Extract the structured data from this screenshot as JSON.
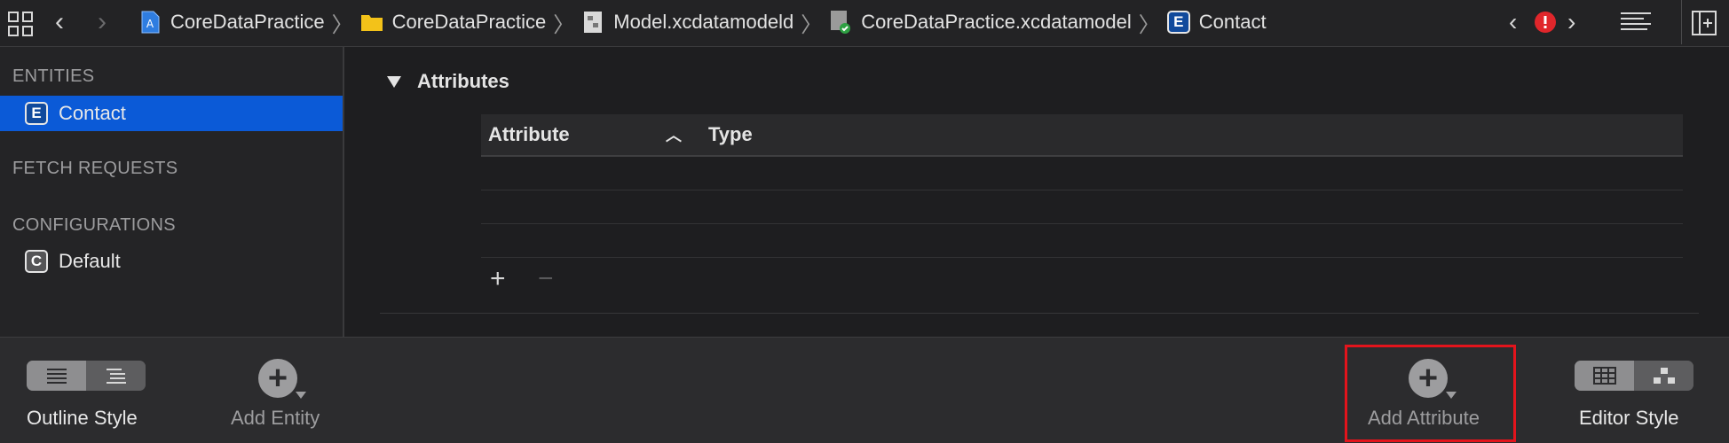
{
  "jumpbar": {
    "crumbs": [
      {
        "label": "CoreDataPractice",
        "icon": "xcode-project-icon"
      },
      {
        "label": "CoreDataPractice",
        "icon": "folder-icon"
      },
      {
        "label": "Model.xcdatamodeld",
        "icon": "datamodel-bundle-icon"
      },
      {
        "label": "CoreDataPractice.xcdatamodel",
        "icon": "datamodel-version-icon"
      },
      {
        "label": "Contact",
        "icon": "entity-icon"
      }
    ],
    "entity_badge": "E"
  },
  "sidebar": {
    "entities_heading": "ENTITIES",
    "entities": [
      {
        "badge": "E",
        "label": "Contact"
      }
    ],
    "fetch_heading": "FETCH REQUESTS",
    "configurations_heading": "CONFIGURATIONS",
    "configurations": [
      {
        "badge": "C",
        "label": "Default"
      }
    ]
  },
  "main": {
    "section_title": "Attributes",
    "columns": [
      "Attribute",
      "Type"
    ]
  },
  "toolbar": {
    "outline_style_label": "Outline Style",
    "add_entity_label": "Add Entity",
    "add_attribute_label": "Add Attribute",
    "editor_style_label": "Editor Style"
  },
  "colors": {
    "selection": "#0b5ad7",
    "error_badge": "#e0262b",
    "highlight_box": "#e3141c"
  }
}
